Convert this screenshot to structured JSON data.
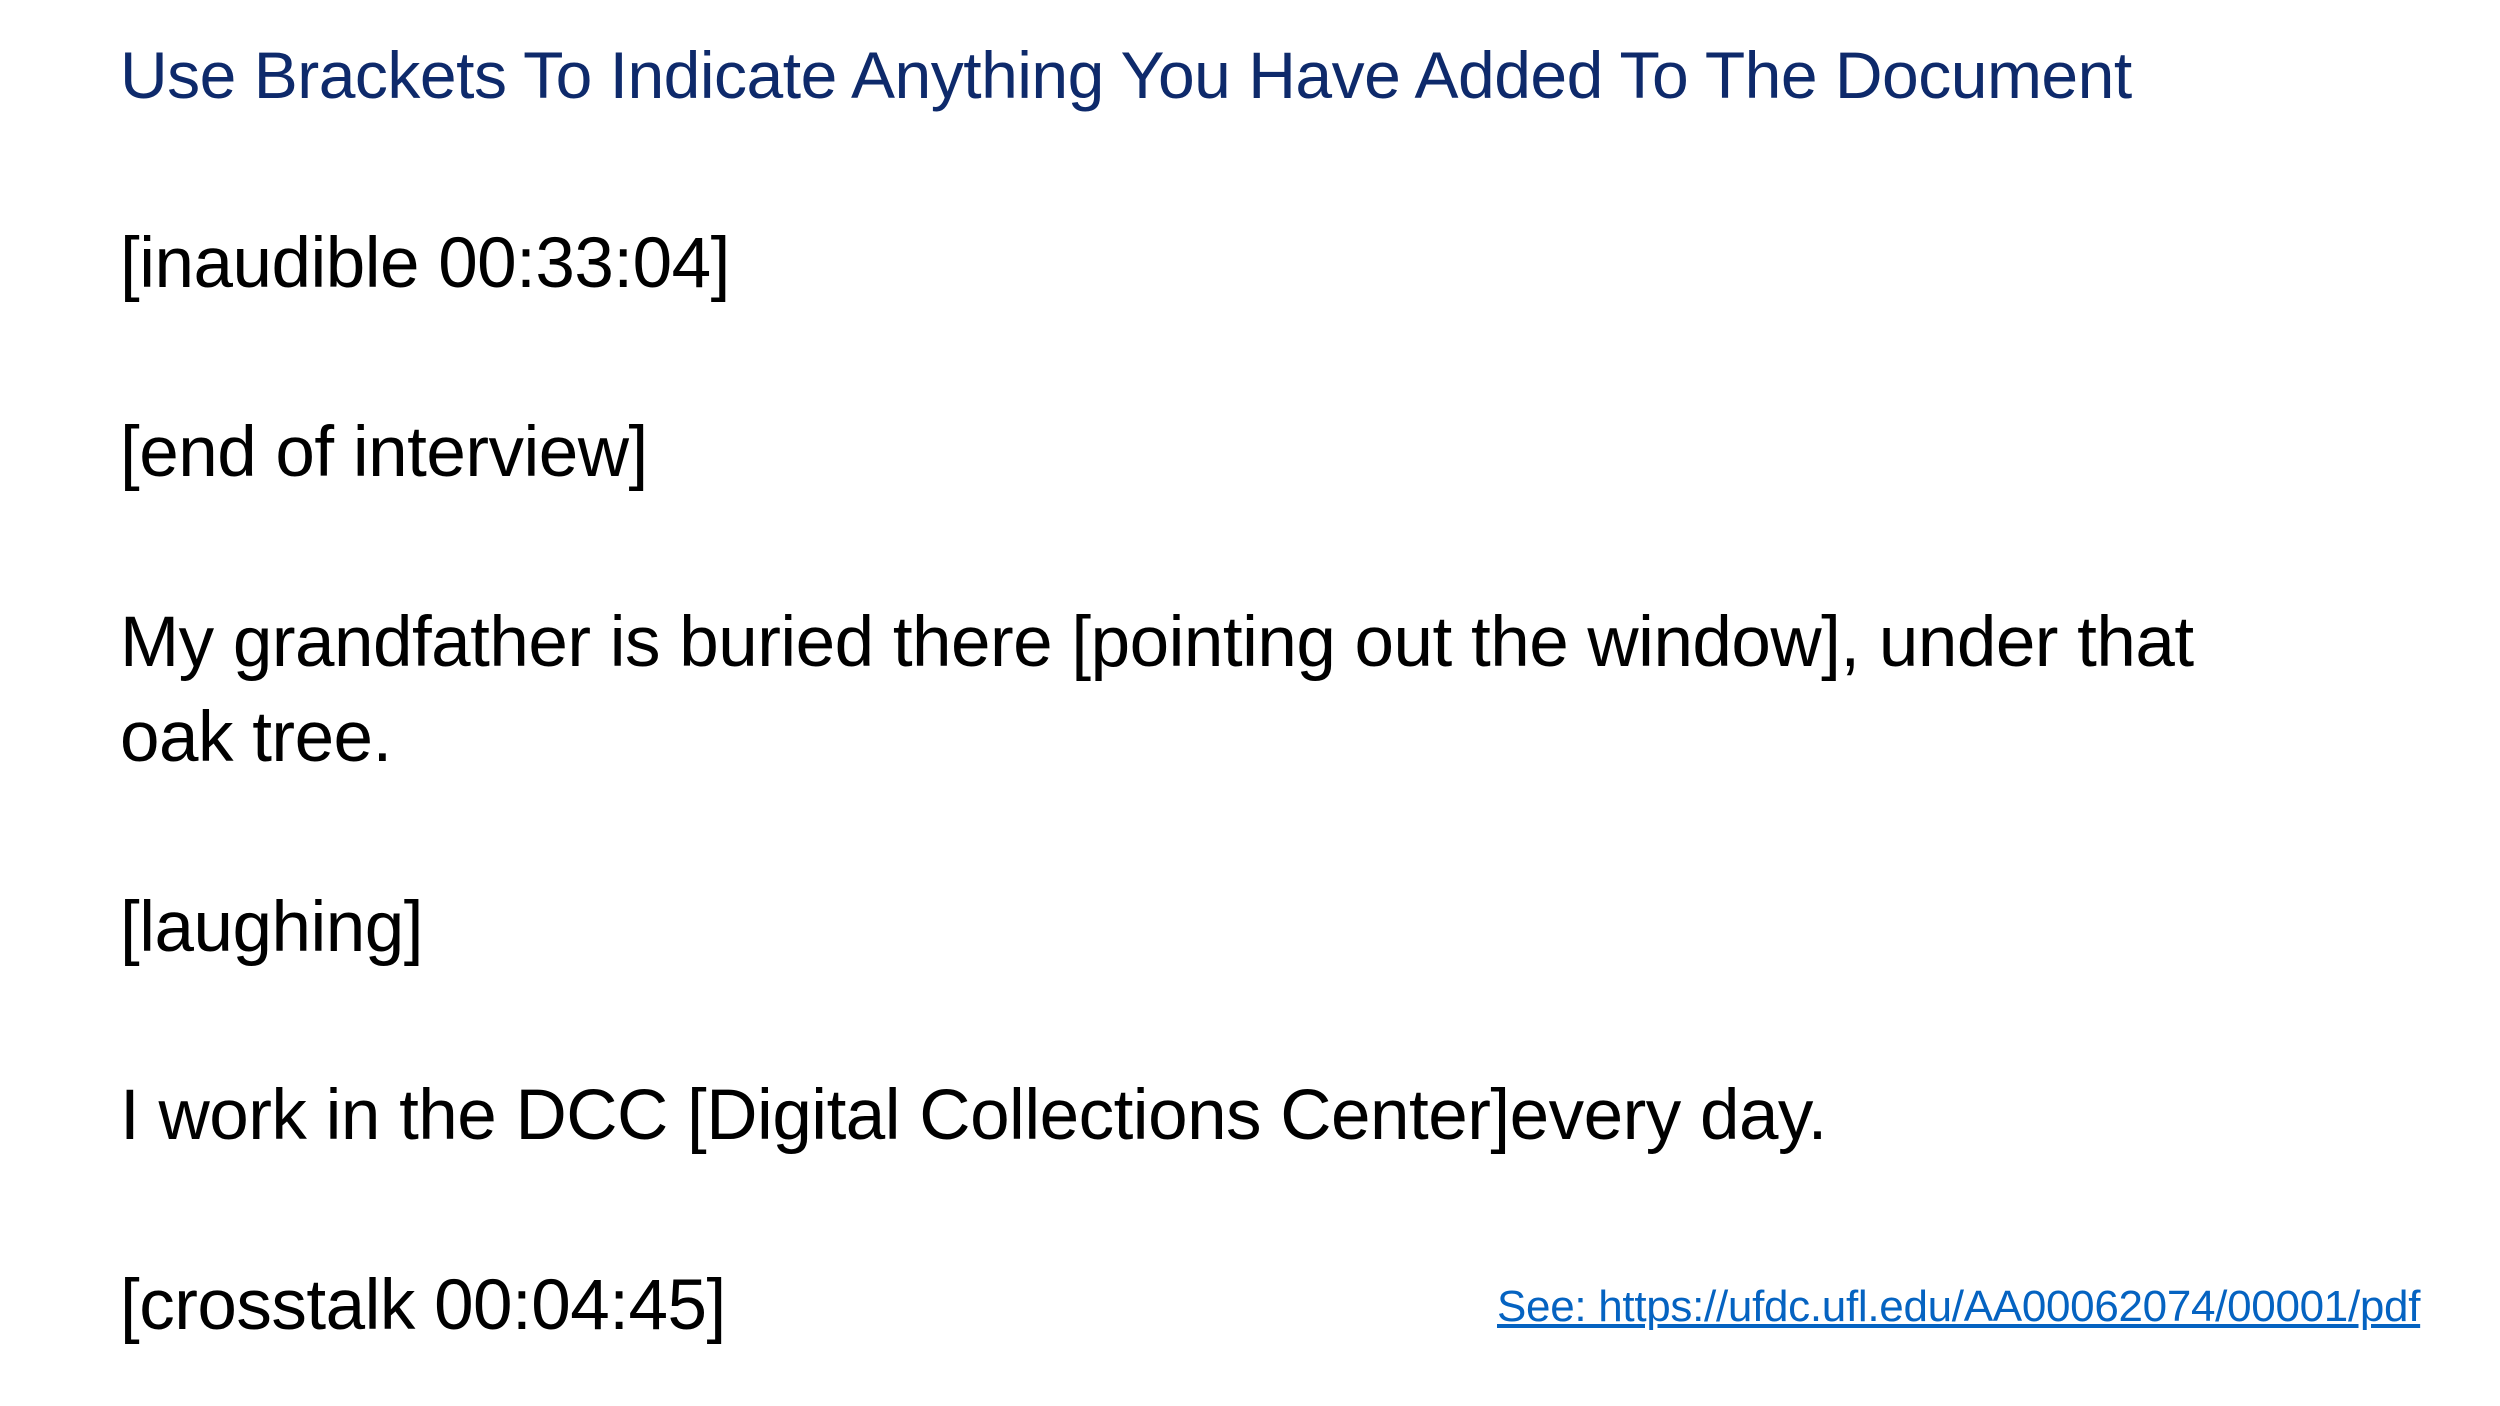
{
  "slide": {
    "title": "Use Brackets To Indicate Anything You Have Added To The Document",
    "examples": [
      "[inaudible 00:33:04]",
      "[end of interview]",
      "My grandfather is buried there [pointing out the window], under that",
      "oak tree.",
      "[laughing]",
      "I work in the DCC [Digital Collections Center]every day.",
      "[crosstalk 00:04:45]"
    ],
    "source_link": "See: https://ufdc.ufl.edu/AA00062074/00001/pdf"
  },
  "colors": {
    "title": "#0e2a6b",
    "body_text": "#000000",
    "link": "#0563c1",
    "background": "#ffffff"
  }
}
